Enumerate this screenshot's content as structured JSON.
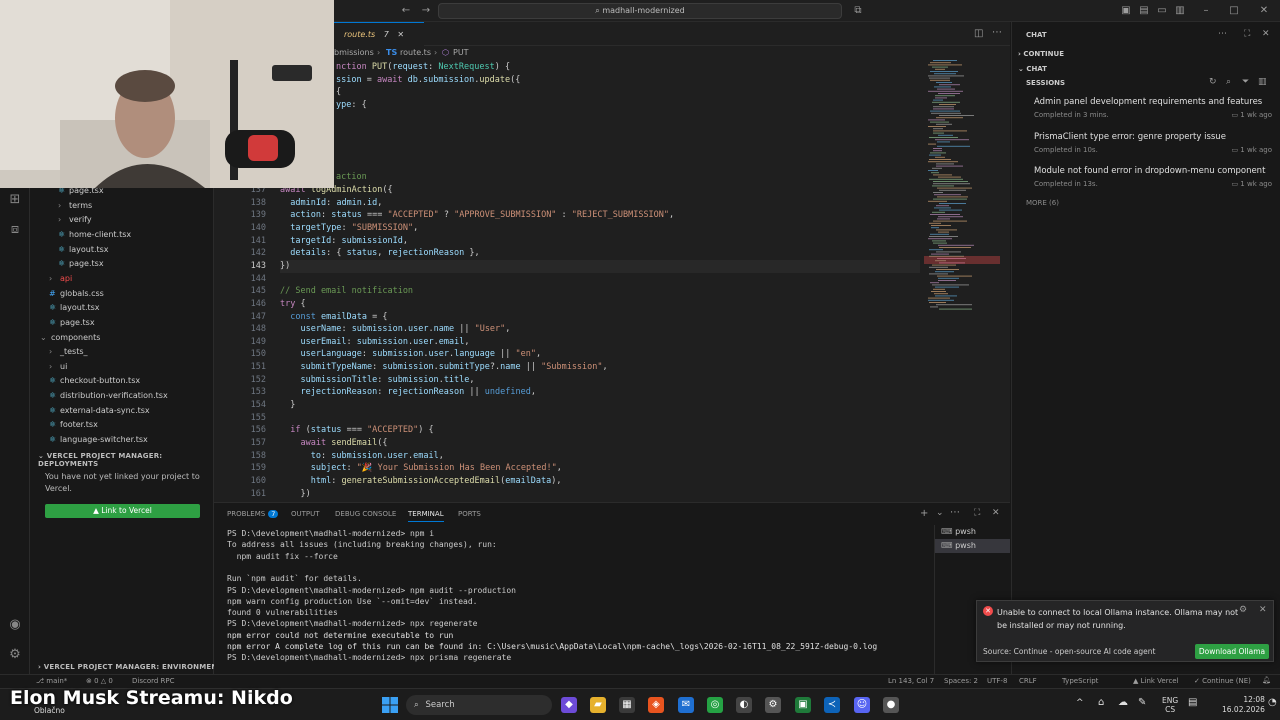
{
  "titlebar": {
    "search": "madhall-modernized"
  },
  "tab": {
    "label": "route.ts",
    "count": "7"
  },
  "breadcrumbs": {
    "seg1": "bmissions",
    "seg2": "route.ts",
    "seg3": "PUT"
  },
  "sidebar": {
    "items": [
      {
        "label": "page.tsx",
        "indent": 2,
        "icon": "react"
      },
      {
        "label": "terms",
        "indent": 2,
        "icon": "chev"
      },
      {
        "label": "verify",
        "indent": 2,
        "icon": "chev"
      },
      {
        "label": "home-client.tsx",
        "indent": 2,
        "icon": "react"
      },
      {
        "label": "layout.tsx",
        "indent": 2,
        "icon": "react"
      },
      {
        "label": "page.tsx",
        "indent": 2,
        "icon": "react"
      },
      {
        "label": "api",
        "indent": 1,
        "icon": "chev"
      },
      {
        "label": "globals.css",
        "indent": 1,
        "icon": "css"
      },
      {
        "label": "layout.tsx",
        "indent": 1,
        "icon": "react"
      },
      {
        "label": "page.tsx",
        "indent": 1,
        "icon": "react"
      },
      {
        "label": "components",
        "indent": 0,
        "icon": "chevd"
      },
      {
        "label": "_tests_",
        "indent": 1,
        "icon": "chev"
      },
      {
        "label": "ui",
        "indent": 1,
        "icon": "chev"
      },
      {
        "label": "checkout-button.tsx",
        "indent": 1,
        "icon": "react"
      },
      {
        "label": "distribution-verification.tsx",
        "indent": 1,
        "icon": "react"
      },
      {
        "label": "external-data-sync.tsx",
        "indent": 1,
        "icon": "react"
      },
      {
        "label": "footer.tsx",
        "indent": 1,
        "icon": "react"
      },
      {
        "label": "language-switcher.tsx",
        "indent": 1,
        "icon": "react"
      }
    ],
    "vercel_deploy_header": "VERCEL PROJECT MANAGER: DEPLOYMENTS",
    "vercel_msg": "You have not yet linked your project to Vercel.",
    "vercel_button": "▲ Link to Vercel",
    "vercel_env_header": "VERCEL PROJECT MANAGER: ENVIRONMENT ..."
  },
  "editor": {
    "top_lines": [
      {
        "ln": "",
        "html": "<span class='kw'>nction</span> <span class='fn'>PUT</span>(<span class='vr'>request</span>: <span class='ty'>NextRequest</span>) {"
      },
      {
        "ln": "",
        "html": "<span class='vr'>ssion</span> = <span class='kw'>await</span> <span class='vr'>db</span>.<span class='vr'>submission</span>.<span class='fn'>update</span>({"
      },
      {
        "ln": "",
        "html": "{"
      },
      {
        "ln": "",
        "html": "<span class='vr'>ype</span>: {"
      }
    ],
    "comment_top": "action",
    "lines": [
      {
        "ln": "137",
        "html": "<span class='kw'>await</span> <span class='fn'>logAdminAction</span>({"
      },
      {
        "ln": "138",
        "html": "  <span class='vr'>adminId</span>: <span class='vr'>admin</span>.<span class='vr'>id</span>,"
      },
      {
        "ln": "139",
        "html": "  <span class='vr'>action</span>: <span class='vr'>status</span> === <span class='st'>\"ACCEPTED\"</span> ? <span class='st'>\"APPROVE_SUBMISSION\"</span> : <span class='st'>\"REJECT_SUBMISSION\"</span>,"
      },
      {
        "ln": "140",
        "html": "  <span class='vr'>targetType</span>: <span class='st'>\"SUBMISSION\"</span>,"
      },
      {
        "ln": "141",
        "html": "  <span class='vr'>targetId</span>: <span class='vr'>submissionId</span>,"
      },
      {
        "ln": "142",
        "html": "  <span class='vr'>details</span>: { <span class='vr'>status</span>, <span class='vr'>rejectionReason</span> },"
      },
      {
        "ln": "143",
        "html": "})"
      },
      {
        "ln": "144",
        "html": ""
      },
      {
        "ln": "145",
        "html": "<span class='cm'>// Send email notification</span>"
      },
      {
        "ln": "146",
        "html": "<span class='kw'>try</span> {"
      },
      {
        "ln": "147",
        "html": "  <span class='bl'>const</span> <span class='vr'>emailData</span> = {"
      },
      {
        "ln": "148",
        "html": "    <span class='vr'>userName</span>: <span class='vr'>submission</span>.<span class='vr'>user</span>.<span class='vr'>name</span> || <span class='st'>\"User\"</span>,"
      },
      {
        "ln": "149",
        "html": "    <span class='vr'>userEmail</span>: <span class='vr'>submission</span>.<span class='vr'>user</span>.<span class='vr'>email</span>,"
      },
      {
        "ln": "150",
        "html": "    <span class='vr'>userLanguage</span>: <span class='vr'>submission</span>.<span class='vr'>user</span>.<span class='vr'>language</span> || <span class='st'>\"en\"</span>,"
      },
      {
        "ln": "151",
        "html": "    <span class='vr'>submitTypeName</span>: <span class='vr'>submission</span>.<span class='vr'>submitType</span>?.<span class='vr'>name</span> || <span class='st'>\"Submission\"</span>,"
      },
      {
        "ln": "152",
        "html": "    <span class='vr'>submissionTitle</span>: <span class='vr'>submission</span>.<span class='vr'>title</span>,"
      },
      {
        "ln": "153",
        "html": "    <span class='vr'>rejectionReason</span>: <span class='vr'>rejectionReason</span> || <span class='bl'>undefined</span>,"
      },
      {
        "ln": "154",
        "html": "  }"
      },
      {
        "ln": "155",
        "html": ""
      },
      {
        "ln": "156",
        "html": "  <span class='kw'>if</span> (<span class='vr'>status</span> === <span class='st'>\"ACCEPTED\"</span>) {"
      },
      {
        "ln": "157",
        "html": "    <span class='kw'>await</span> <span class='fn'>sendEmail</span>({"
      },
      {
        "ln": "158",
        "html": "      <span class='vr'>to</span>: <span class='vr'>submission</span>.<span class='vr'>user</span>.<span class='vr'>email</span>,"
      },
      {
        "ln": "159",
        "html": "      <span class='vr'>subject</span>: <span class='st'>\"🎉 Your Submission Has Been Accepted!\"</span>,"
      },
      {
        "ln": "160",
        "html": "      <span class='vr'>html</span>: <span class='fn'>generateSubmissionAcceptedEmail</span>(<span class='vr'>emailData</span>),"
      },
      {
        "ln": "161",
        "html": "    })"
      }
    ]
  },
  "panel": {
    "tabs": [
      "PROBLEMS",
      "OUTPUT",
      "DEBUG CONSOLE",
      "TERMINAL",
      "PORTS"
    ],
    "problems_count": "7",
    "terminals": [
      "pwsh",
      "pwsh"
    ],
    "lines": [
      {
        "cls": "prompt",
        "text": "PS D:\\development\\madhall-modernized> npm i"
      },
      {
        "cls": "prompt",
        "text": "To address all issues (including breaking changes), run:"
      },
      {
        "cls": "prompt",
        "text": "  npm audit fix --force"
      },
      {
        "cls": "prompt",
        "text": ""
      },
      {
        "cls": "prompt",
        "text": "Run `npm audit` for details."
      },
      {
        "cls": "prompt",
        "text": "PS D:\\development\\madhall-modernized> npm audit --production"
      },
      {
        "cls": "prompt",
        "text": "npm warn config production Use `--omit=dev` instead."
      },
      {
        "cls": "prompt",
        "text": "found 0 vulnerabilities"
      },
      {
        "cls": "prompt",
        "text": "PS D:\\development\\madhall-modernized> npx regenerate"
      },
      {
        "cls": "prompt",
        "text": "npm error could not determine executable to run"
      },
      {
        "cls": "prompt",
        "text": "npm error A complete log of this run can be found in: C:\\Users\\music\\AppData\\Local\\npm-cache\\_logs\\2026-02-16T11_08_22_591Z-debug-0.log"
      },
      {
        "cls": "prompt",
        "text": "PS D:\\development\\madhall-modernized> npx prisma regenerate"
      }
    ]
  },
  "chat": {
    "header": "CHAT",
    "continue": "CONTINUE",
    "chat2": "CHAT",
    "sessions": "SESSIONS",
    "items": [
      {
        "title": "Admin panel development requirements and features",
        "sub": "Completed in 3 mins.",
        "time": "1 wk ago"
      },
      {
        "title": "PrismaClient type error: genre property issue",
        "sub": "Completed in 10s.",
        "time": "1 wk ago"
      },
      {
        "title": "Module not found error in dropdown-menu component",
        "sub": "Completed in 13s.",
        "time": "1 wk ago"
      }
    ],
    "more": "MORE (6)"
  },
  "notification": {
    "message": "Unable to connect to local Ollama instance. Ollama may not be installed or may not running.",
    "source": "Source: Continue - open-source AI code agent",
    "button": "Download Ollama"
  },
  "status": {
    "branch": "main*",
    "errors": "0",
    "warnings": "0",
    "discord": "Discord RPC",
    "position": "Ln 143, Col 7",
    "spaces": "Spaces: 2",
    "encoding": "UTF-8",
    "eol": "CRLF",
    "language": "TypeScript",
    "vercel": "Link Vercel",
    "continue": "Continue (NE)"
  },
  "taskbar": {
    "overlay_text": "Elon Musk Streamu: Nikdo",
    "weather": "Oblačno",
    "search": "Search",
    "lang1": "ENG",
    "lang2": "CS",
    "time": "12:08",
    "date": "16.02.2026"
  },
  "colors": {
    "accent": "#0078d4",
    "error": "#f14c4c",
    "button_green": "#2ea043"
  }
}
